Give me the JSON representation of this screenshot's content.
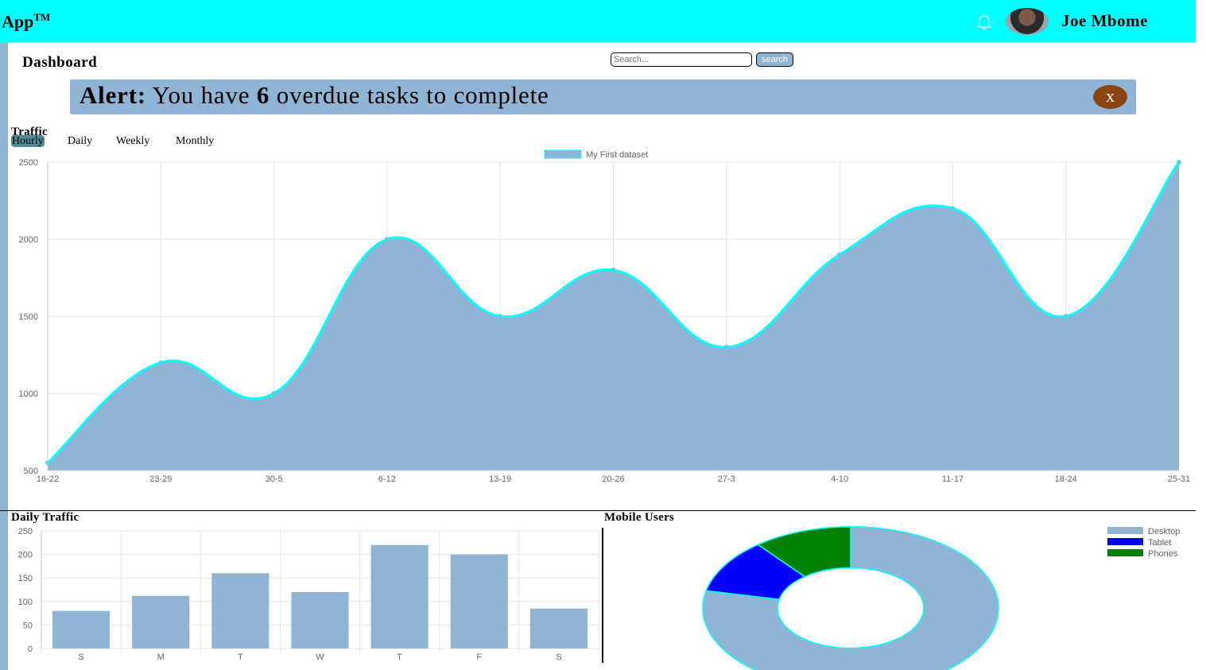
{
  "header": {
    "brand": "App",
    "brand_mark": "TM",
    "user_name": "Joe Mbome",
    "bell_icon": "bell-icon"
  },
  "page": {
    "title": "Dashboard"
  },
  "search": {
    "placeholder": "Search...",
    "button_label": "search"
  },
  "alert": {
    "prefix": "Alert:",
    "message_start": "You have",
    "count": "6",
    "message_end": "overdue tasks to complete",
    "close_label": "x"
  },
  "traffic": {
    "title": "Traffic",
    "tabs": [
      {
        "label": "Hourly",
        "active": true
      },
      {
        "label": "Daily",
        "active": false
      },
      {
        "label": "Weekly",
        "active": false
      },
      {
        "label": "Monthly",
        "active": false
      }
    ]
  },
  "daily_traffic": {
    "title": "Daily Traffic"
  },
  "mobile_users": {
    "title": "Mobile Users"
  },
  "colors": {
    "accent": "#00ffff",
    "fill": "#90b4d4",
    "tablet": "#0000ff",
    "phones": "#008000",
    "alert_close": "#8b4513"
  },
  "chart_data": [
    {
      "type": "area",
      "categories": [
        "16-22",
        "23-29",
        "30-5",
        "6-12",
        "13-19",
        "20-26",
        "27-3",
        "4-10",
        "11-17",
        "18-24",
        "25-31"
      ],
      "series": [
        {
          "name": "My First dataset",
          "values": [
            550,
            1200,
            1000,
            2000,
            1500,
            1800,
            1300,
            1900,
            2200,
            1500,
            2500
          ]
        }
      ],
      "ylim": [
        500,
        2500
      ],
      "yticks": [
        500,
        1000,
        1500,
        2000,
        2500
      ],
      "legend": "top",
      "grid": true
    },
    {
      "type": "bar",
      "categories": [
        "S",
        "M",
        "T",
        "W",
        "T",
        "F",
        "S"
      ],
      "values": [
        80,
        112,
        160,
        120,
        220,
        200,
        85
      ],
      "ylim": [
        0,
        250
      ],
      "yticks": [
        0,
        50,
        100,
        150,
        200,
        250
      ],
      "grid": true
    },
    {
      "type": "pie",
      "categories": [
        "Desktop",
        "Tablet",
        "Phones"
      ],
      "values": [
        2000,
        275,
        275
      ],
      "legend": "top-right"
    }
  ]
}
